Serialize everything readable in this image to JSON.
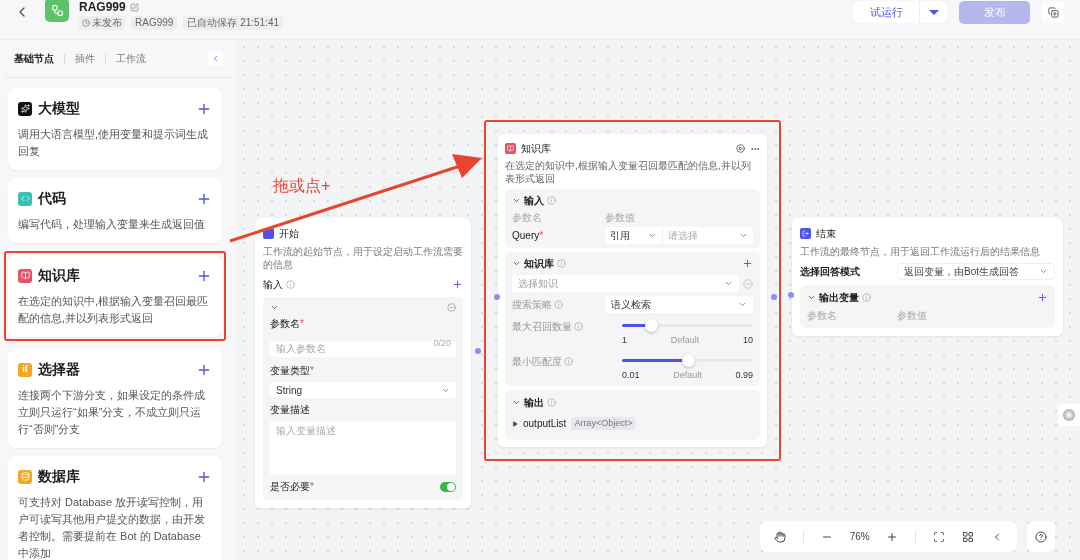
{
  "header": {
    "title": "RAG999",
    "status": "未发布",
    "tag": "RAG999",
    "saved": "已自动保存 21:51:41",
    "test_run": "试运行",
    "publish": "发布"
  },
  "sidebar": {
    "tabs": [
      {
        "label": "基础节点",
        "selected": true
      },
      {
        "label": "插件",
        "selected": false
      },
      {
        "label": "工作流",
        "selected": false
      }
    ],
    "nodes": [
      {
        "kind": "llm",
        "title": "大模型",
        "description": "调用大语言模型,使用变量和提示词生成回复",
        "highlighted": false
      },
      {
        "kind": "code",
        "title": "代码",
        "description": "编写代码，处理输入变量来生成返回值",
        "highlighted": false
      },
      {
        "kind": "knowledge",
        "title": "知识库",
        "description": "在选定的知识中,根据输入变量召回最匹配的信息,并以列表形式返回",
        "highlighted": true
      },
      {
        "kind": "selector",
        "badge": "if",
        "title": "选择器",
        "description": "连接两个下游分支，如果设定的条件成立则只运行“如果”分支，不成立则只运行“否则”分支",
        "highlighted": false
      },
      {
        "kind": "database",
        "title": "数据库",
        "description": "可支持对 Database 放开读写控制，用户可读写其他用户提交的数据，由开发者控制。需要提前在 Bot 的 Database 中添加",
        "highlighted": false
      }
    ]
  },
  "annotation": {
    "label": "拖或点+"
  },
  "start_node": {
    "title": "开始",
    "description": "工作流的起始节点，用于设定启动工作流需要的信息",
    "section": "输入",
    "param_label": "参数名",
    "param_mark": "*",
    "param_placeholder": "输入参数名",
    "param_counter": "0/20",
    "type_label": "变量类型",
    "type_mark": "*",
    "type_value": "String",
    "desc_label": "变量描述",
    "desc_placeholder": "输入变量描述",
    "required_label": "是否必要",
    "required_mark": "*",
    "required_on": true
  },
  "knowledge_node": {
    "title": "知识库",
    "description": "在选定的知识中,根据输入变量召回最匹配的信息,并以列表形式返回",
    "highlighted": true,
    "input": {
      "title": "输入",
      "columns": [
        "参数名",
        "参数值"
      ],
      "param": "Query",
      "param_mark": "*",
      "source": "引用",
      "value_placeholder": "请选择"
    },
    "knowledge": {
      "title": "知识库",
      "select_placeholder": "选择知识",
      "strategy_label": "搜索策略",
      "strategy_value": "语义检索",
      "sliders": [
        {
          "label": "最大召回数量",
          "level": 0.22,
          "min": "1",
          "default": "Default",
          "max": "10"
        },
        {
          "label": "最小匹配度",
          "level": 0.5,
          "min": "0.01",
          "default": "Default",
          "max": "0.99"
        }
      ]
    },
    "output": {
      "title": "输出",
      "name": "outputList",
      "type": "Array<Object>"
    }
  },
  "end_node": {
    "title": "结束",
    "description": "工作流的最终节点，用于返回工作流运行后的结果信息",
    "mode_label": "选择回答模式",
    "mode_value": "返回变量，由Bot生成回答",
    "section": "输出变量",
    "columns": [
      "参数名",
      "参数值"
    ]
  },
  "toolbar": {
    "zoom": "76%"
  }
}
